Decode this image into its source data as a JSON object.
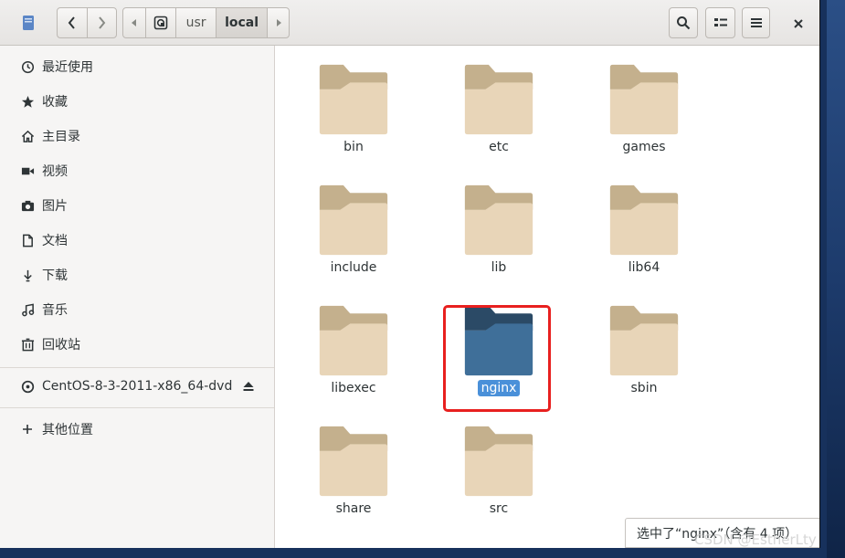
{
  "window": {
    "path": {
      "segments": [
        "usr",
        "local"
      ],
      "current": "local"
    }
  },
  "sidebar": {
    "items": [
      {
        "label": "最近使用",
        "icon": "clock-icon"
      },
      {
        "label": "收藏",
        "icon": "star-icon"
      },
      {
        "label": "主目录",
        "icon": "home-icon"
      },
      {
        "label": "视频",
        "icon": "video-icon"
      },
      {
        "label": "图片",
        "icon": "camera-icon"
      },
      {
        "label": "文档",
        "icon": "document-icon"
      },
      {
        "label": "下载",
        "icon": "download-icon"
      },
      {
        "label": "音乐",
        "icon": "music-icon"
      },
      {
        "label": "回收站",
        "icon": "trash-icon"
      }
    ],
    "device": {
      "label": "CentOS-8-3-2011-x86_64-dvd",
      "icon": "disc-icon"
    },
    "other": {
      "label": "其他位置",
      "icon": "plus-icon"
    }
  },
  "folders": [
    {
      "name": "bin"
    },
    {
      "name": "etc"
    },
    {
      "name": "games"
    },
    {
      "name": "include"
    },
    {
      "name": "lib"
    },
    {
      "name": "lib64"
    },
    {
      "name": "libexec"
    },
    {
      "name": "nginx",
      "selected": true
    },
    {
      "name": "sbin"
    },
    {
      "name": "share"
    },
    {
      "name": "src"
    }
  ],
  "statusbar": {
    "text": "选中了“nginx”（含有 4 项）"
  },
  "watermark": {
    "text": "CSDN @EstherLty"
  },
  "colors": {
    "folder_body": "#e8d5b8",
    "folder_tab": "#c4b08d",
    "selected_folder_body": "#3f6f99",
    "selected_folder_tab": "#2b4a66",
    "selection": "#4a90d9",
    "highlight_box": "#e8201f"
  }
}
